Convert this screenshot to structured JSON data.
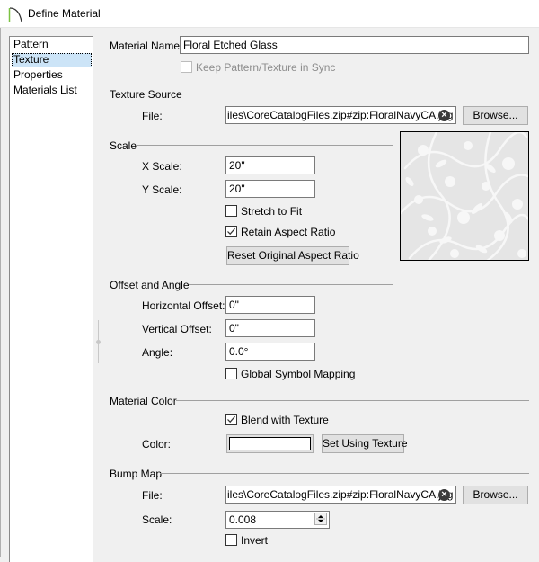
{
  "window": {
    "title": "Define Material",
    "icon": "chief-architect-arc-icon"
  },
  "sidebar": {
    "items": [
      {
        "label": "Pattern",
        "selected": false
      },
      {
        "label": "Texture",
        "selected": true
      },
      {
        "label": "Properties",
        "selected": false
      },
      {
        "label": "Materials List",
        "selected": false
      }
    ]
  },
  "material": {
    "name_label": "Material Name:",
    "name_value": "Floral Etched Glass",
    "keep_sync_label": "Keep Pattern/Texture in Sync",
    "keep_sync_checked": false,
    "keep_sync_enabled": false
  },
  "texture_source": {
    "title": "Texture Source",
    "file_label": "File:",
    "file_value": "iles\\CoreCatalogFiles.zip#zip:FloralNavyCA.jpg",
    "clear_icon": "clear-circle-x-icon",
    "browse_label": "Browse..."
  },
  "scale": {
    "title": "Scale",
    "x_label": "X Scale:",
    "x_value": "20\"",
    "y_label": "Y Scale:",
    "y_value": "20\"",
    "stretch_label": "Stretch to Fit",
    "stretch_checked": false,
    "retain_label": "Retain Aspect Ratio",
    "retain_checked": true,
    "reset_label": "Reset Original Aspect Ratio"
  },
  "preview": {
    "description": "floral etched glass texture preview",
    "base_color": "#e5e5e5",
    "pattern_color": "#f7f7f7"
  },
  "offset_angle": {
    "title": "Offset and Angle",
    "h_label": "Horizontal Offset:",
    "h_value": "0\"",
    "v_label": "Vertical Offset:",
    "v_value": "0\"",
    "angle_label": "Angle:",
    "angle_value": "0.0°",
    "global_label": "Global Symbol Mapping",
    "global_checked": false
  },
  "material_color": {
    "title": "Material Color",
    "blend_label": "Blend with Texture",
    "blend_checked": true,
    "color_label": "Color:",
    "color_value": "#ffffff",
    "set_using_label": "Set Using Texture"
  },
  "bump_map": {
    "title": "Bump Map",
    "file_label": "File:",
    "file_value": "iles\\CoreCatalogFiles.zip#zip:FloralNavyCA.jpg",
    "browse_label": "Browse...",
    "scale_label": "Scale:",
    "scale_value": "0.008",
    "invert_label": "Invert",
    "invert_checked": false
  }
}
